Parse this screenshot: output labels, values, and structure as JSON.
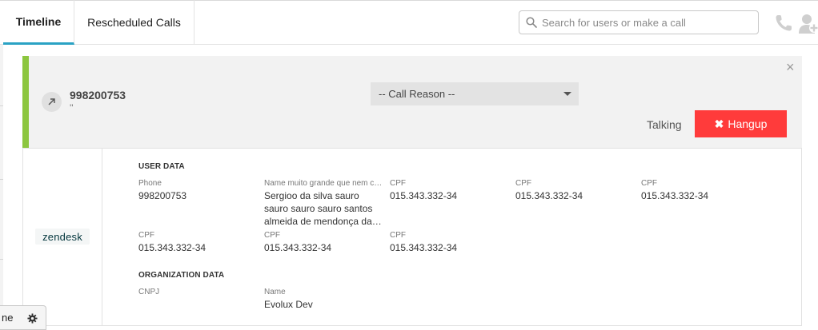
{
  "tabs": [
    {
      "label": "Timeline",
      "active": true
    },
    {
      "label": "Rescheduled Calls",
      "active": false
    }
  ],
  "search": {
    "placeholder": "Search for users or make a call",
    "value": ""
  },
  "header_icons": [
    "phone-icon",
    "add-user-icon"
  ],
  "call": {
    "number": "998200753",
    "subtitle": "''",
    "direction_icon": "outbound-arrow-icon",
    "reason_placeholder": "-- Call Reason --",
    "status": "Talking",
    "hangup_label": "Hangup",
    "close_icon": "close-icon",
    "accent_color": "#8cc63f",
    "hangup_color": "#ff3b3b"
  },
  "integration": {
    "logo_text": "zendesk"
  },
  "user_data": {
    "title": "USER DATA",
    "fields": [
      {
        "label": "Phone",
        "value": "998200753"
      },
      {
        "label": "Name muito grande que nem cabe",
        "value": "Sergioo da silva sauro sauro sauro sauro santos almeida de mendonça da silva"
      },
      {
        "label": "CPF",
        "value": "015.343.332-34"
      },
      {
        "label": "CPF",
        "value": "015.343.332-34"
      },
      {
        "label": "CPF",
        "value": "015.343.332-34"
      },
      {
        "label": "CPF",
        "value": "015.343.332-34"
      },
      {
        "label": "CPF",
        "value": "015.343.332-34"
      },
      {
        "label": "CPF",
        "value": "015.343.332-34"
      }
    ]
  },
  "organization_data": {
    "title": "ORGANIZATION DATA",
    "fields": [
      {
        "label": "CNPJ",
        "value": ""
      },
      {
        "label": "Name",
        "value": "Evolux Dev"
      }
    ]
  },
  "bottom_pill": {
    "label": "ne",
    "icon": "gear-icon"
  }
}
